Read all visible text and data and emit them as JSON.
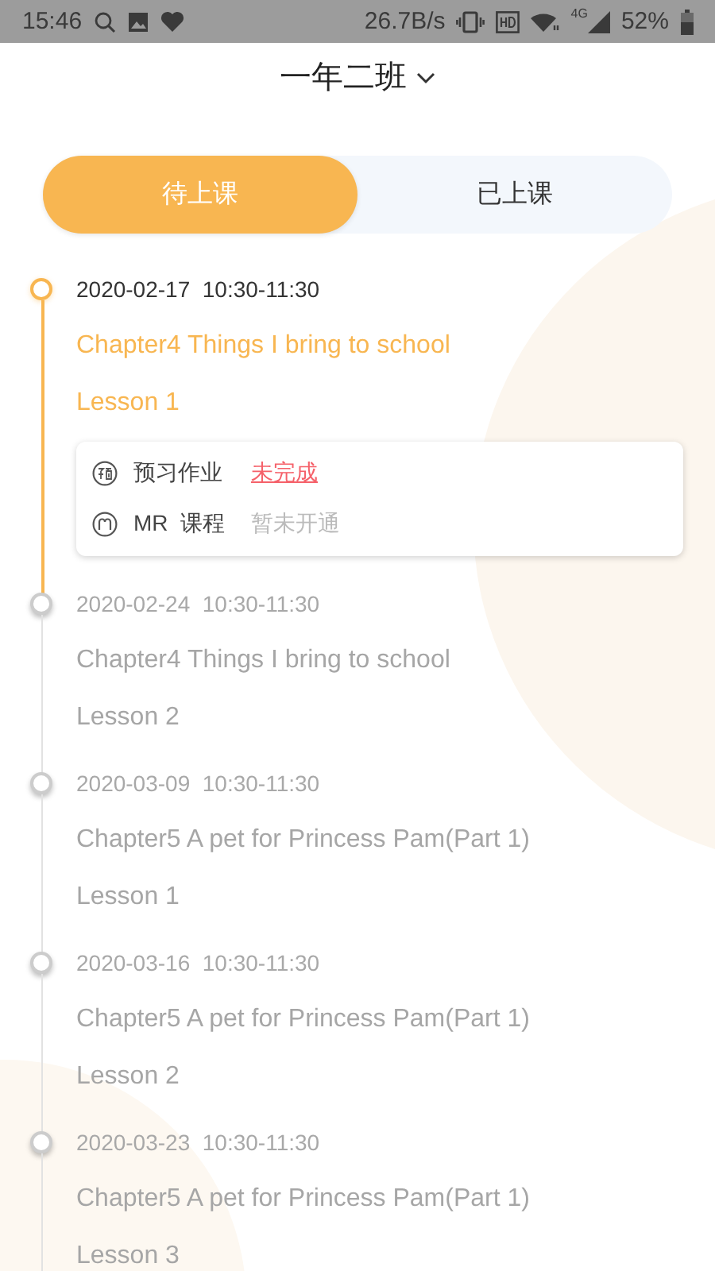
{
  "status_bar": {
    "time": "15:46",
    "speed": "26.7B/s",
    "network": "4G",
    "battery": "52%"
  },
  "header": {
    "title": "一年二班"
  },
  "tabs": [
    {
      "label": "待上课",
      "selected": true
    },
    {
      "label": "已上课",
      "selected": false
    }
  ],
  "lessons": [
    {
      "datetime": "2020-02-17  10:30-11:30",
      "title": "Chapter4 Things I bring to school",
      "lesson": "Lesson 1",
      "active": true,
      "tasks": [
        {
          "label": "预习作业",
          "status": "未完成",
          "kind": "link"
        },
        {
          "label": "MR  课程",
          "status": "暂未开通",
          "kind": "note"
        }
      ]
    },
    {
      "datetime": "2020-02-24  10:30-11:30",
      "title": "Chapter4 Things I bring to school",
      "lesson": "Lesson 2",
      "active": false
    },
    {
      "datetime": "2020-03-09  10:30-11:30",
      "title": "Chapter5 A pet for Princess Pam(Part 1)",
      "lesson": "Lesson 1",
      "active": false
    },
    {
      "datetime": "2020-03-16  10:30-11:30",
      "title": "Chapter5 A pet for Princess Pam(Part 1)",
      "lesson": "Lesson 2",
      "active": false
    },
    {
      "datetime": "2020-03-23  10:30-11:30",
      "title": "Chapter5 A pet for Princess Pam(Part 1)",
      "lesson": "Lesson 3",
      "active": false
    }
  ]
}
